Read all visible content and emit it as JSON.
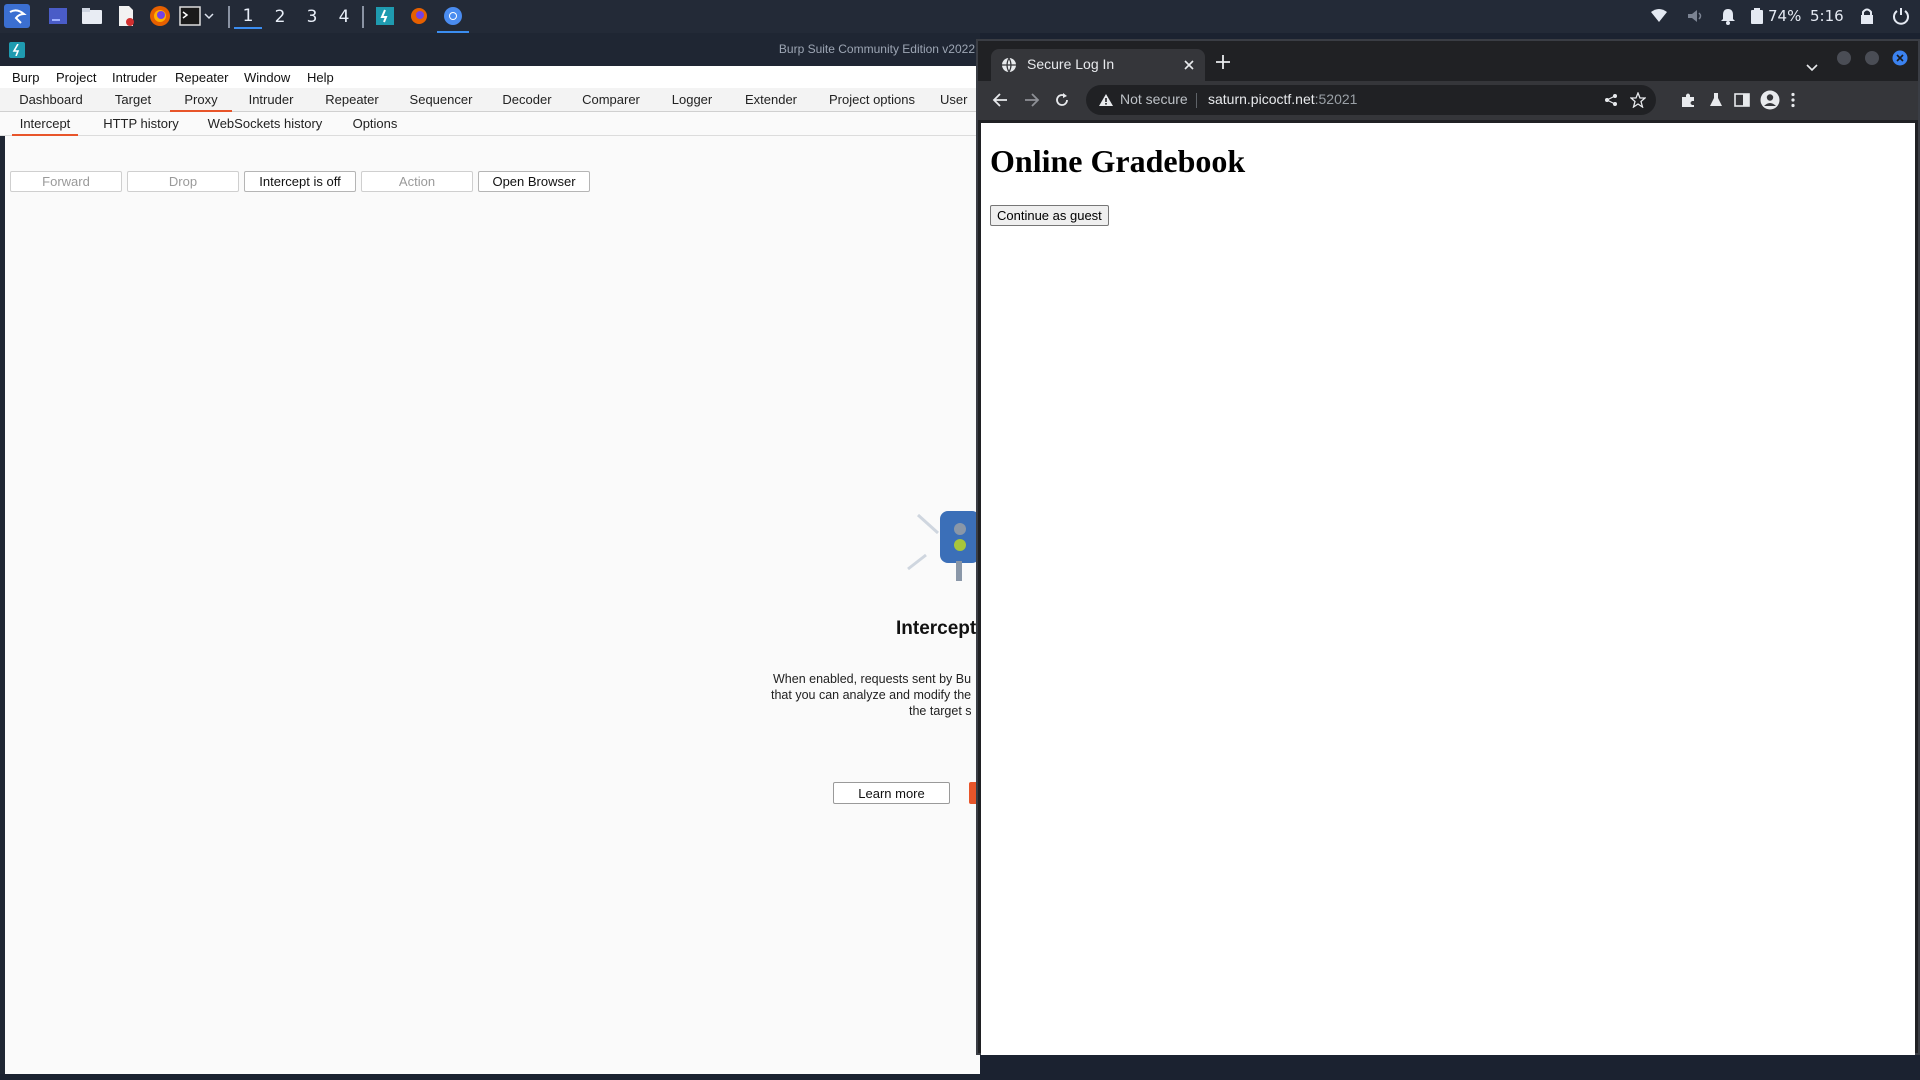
{
  "taskbar": {
    "workspaces": [
      "1",
      "2",
      "3",
      "4"
    ],
    "active_workspace": "1",
    "battery": "74%",
    "clock": "5:16",
    "icons": [
      "kali-menu-icon",
      "desktop-icon",
      "file-manager-icon",
      "text-editor-icon",
      "firefox-icon",
      "terminal-icon",
      "chevron-down-icon",
      "burp-app-icon",
      "firefox-app-icon",
      "chromium-app-icon",
      "network-icon",
      "volume-icon",
      "notification-icon",
      "battery-icon",
      "lock-icon",
      "power-icon"
    ]
  },
  "burp": {
    "window_title": "Burp Suite Community Edition v2022",
    "menu": [
      "Burp",
      "Project",
      "Intruder",
      "Repeater",
      "Window",
      "Help"
    ],
    "tabs": [
      "Dashboard",
      "Target",
      "Proxy",
      "Intruder",
      "Repeater",
      "Sequencer",
      "Decoder",
      "Comparer",
      "Logger",
      "Extender",
      "Project options",
      "User"
    ],
    "active_tab": "Proxy",
    "subtabs": [
      "Intercept",
      "HTTP history",
      "WebSockets history",
      "Options"
    ],
    "active_subtab": "Intercept",
    "buttons": {
      "forward": "Forward",
      "drop": "Drop",
      "intercept": "Intercept is off",
      "action": "Action",
      "open_browser": "Open Browser"
    },
    "panel": {
      "title": "Intercept",
      "desc_line1": "When enabled, requests sent by Bu",
      "desc_line2": "that you can analyze and modify the",
      "desc_line3": "the target s",
      "learn_more": "Learn more"
    },
    "accent": "#e8552a"
  },
  "chrome": {
    "tab_title": "Secure Log In",
    "security": "Not secure",
    "url_host": "saturn.picoctf.net",
    "url_port": ":52021",
    "page": {
      "heading": "Online Gradebook",
      "button": "Continue as guest"
    }
  }
}
